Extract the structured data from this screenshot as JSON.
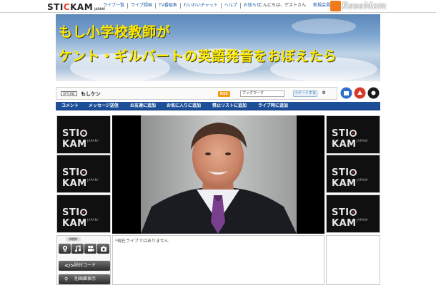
{
  "header": {
    "logo_main": "STICKAM",
    "logo_sub": "JAPAN!",
    "nav": [
      "ライブ一覧",
      "ライブ録画",
      "TV番組表",
      "わいわいチャット",
      "ヘルプ",
      "お知らせ"
    ],
    "greeting": "こんにちは、ゲストさん",
    "register": "新規会員登録",
    "watermark": "ReseMom"
  },
  "banner": {
    "line1": "もし小学校教師が",
    "line2": "ケント・ギルバートの英語発音をおぼえたら"
  },
  "channel": {
    "status_badge": "OFFLINE",
    "name": "もしケン",
    "rss_label": "RSS",
    "bookmark_label": "ブックマーク",
    "tweet_label": "ツイートする",
    "tweet_count": "0"
  },
  "actions": [
    "コメント",
    "メッセージ送信",
    "お友達に追加",
    "お気に入りに追加",
    "禁止リストに追加",
    "ライブ時に追加"
  ],
  "side_tiles": {
    "logo": "STICKAM",
    "sub": "JAPAN!"
  },
  "controls": {
    "viewers_label": "視聴数:",
    "embed_label": "貼付コード",
    "popup_label": "別画面表示"
  },
  "chat": {
    "notice": "*現在ライブではありません"
  },
  "colors": {
    "action_bar": "#1c4f98",
    "banner_text": "#ffea00",
    "link": "#1a5aa8"
  }
}
